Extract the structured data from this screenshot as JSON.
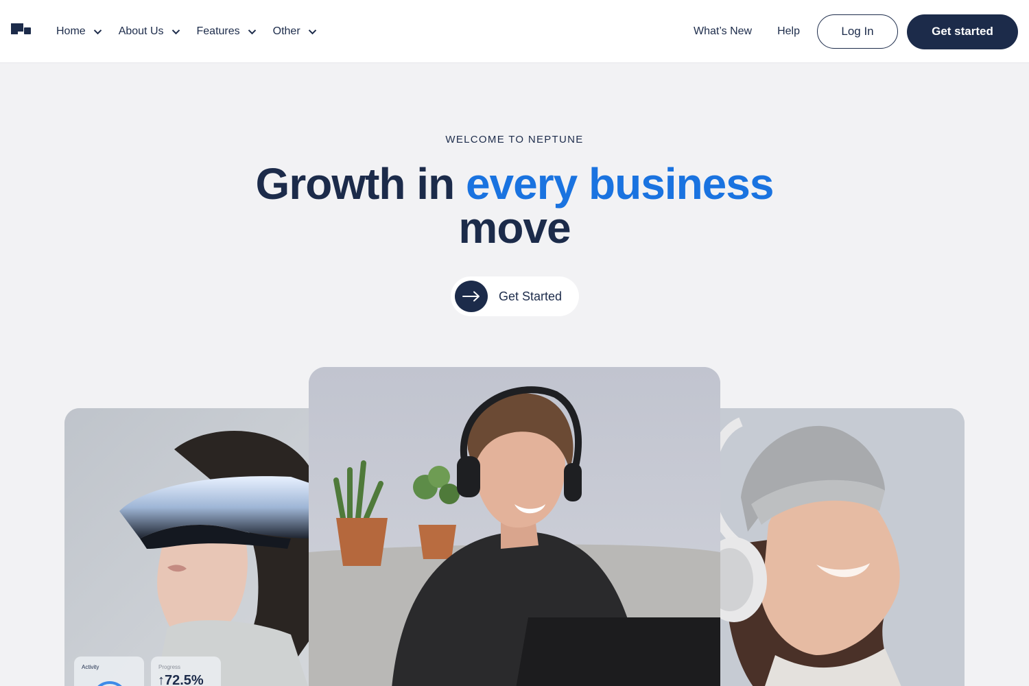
{
  "header": {
    "logo_icon": "neptune-logo-icon",
    "nav": [
      {
        "label": "Home"
      },
      {
        "label": "About Us"
      },
      {
        "label": "Features"
      },
      {
        "label": "Other"
      }
    ],
    "whats_new": "What’s New",
    "help": "Help",
    "login": "Log In",
    "get_started": "Get started"
  },
  "hero": {
    "eyebrow": "WELCOME TO NEPTUNE",
    "headline_part1": "Growth in ",
    "headline_accent": "every business",
    "headline_part2": "move",
    "cta_label": "Get Started",
    "cta_icon": "arrow-right-icon"
  },
  "cards": {
    "left": {
      "photo": "woman-vr-headset-photo",
      "activity_title": "Activity",
      "progress_title": "Progress",
      "progress_value": "↑72.5%"
    },
    "center": {
      "photo": "man-headphones-laptop-photo"
    },
    "right": {
      "photo": "woman-headphones-beanie-photo"
    }
  },
  "colors": {
    "brand_navy": "#1c2b4a",
    "accent_blue": "#1a73e0",
    "page_bg": "#f2f2f4"
  }
}
